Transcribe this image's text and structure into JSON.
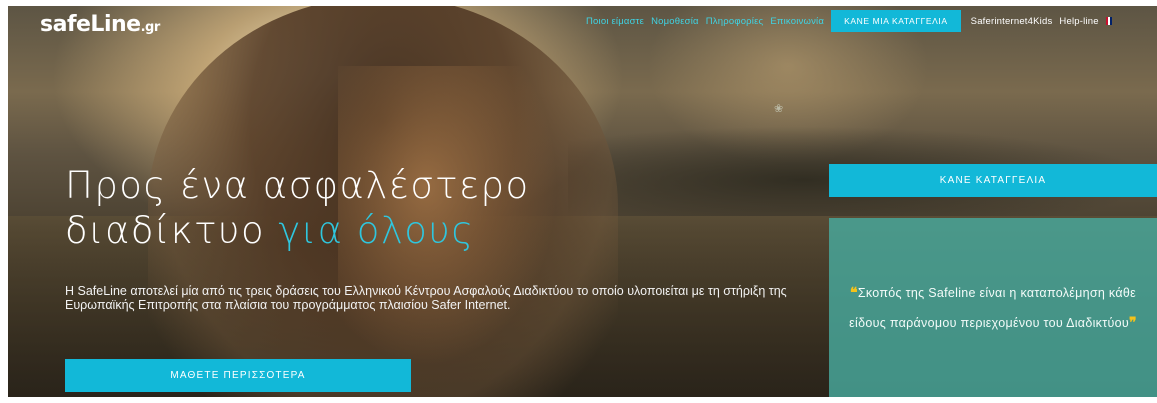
{
  "brand": {
    "logo_text": "safeLine",
    "logo_tld": ".gr"
  },
  "nav": {
    "items": [
      {
        "label": "Ποιοι είμαστε"
      },
      {
        "label": "Νομοθεσία"
      },
      {
        "label": "Πληροφορίες"
      },
      {
        "label": "Επικοινωνία"
      }
    ],
    "cta_label": "ΚΑΝΕ ΜΙΑ ΚΑΤΑΓΓΕΛΙΑ",
    "extra_items": [
      {
        "label": "Saferinternet4Kids"
      },
      {
        "label": "Help-line"
      }
    ],
    "language_icon": "uk-flag-icon"
  },
  "hero": {
    "headline_line1": "Προς ένα ασφαλέστερο",
    "headline_line2_main": "διαδίκτυο",
    "headline_line2_accent": "για όλους",
    "description": "Η SafeLine αποτελεί μία από τις τρεις δράσεις του Ελληνικού Κέντρου Ασφαλούς Διαδικτύου το οποίο υλοποιείται με τη στήριξη της Ευρωπαϊκής Επιτροπής στα πλαίσια του προγράμματος πλαισίου Safer Internet.",
    "learn_more_label": "ΜΑΘΕΤΕ ΠΕΡΙΣΣΟΤΕΡΑ"
  },
  "sidebar": {
    "report_label": "ΚΑΝΕ ΚΑΤΑΓΓΕΛΙΑ",
    "mission_open_quote": "❝",
    "mission_text": "Σκοπός της Safeline είναι η καταπολέμηση κάθε είδους παράνομου περιεχομένου του Διαδικτύου",
    "mission_close_quote": "❞"
  },
  "colors": {
    "accent": "#12b8d8",
    "nav_link": "#3fd3e3",
    "mission_box": "#48aa9e",
    "quote": "#f4c21a"
  }
}
